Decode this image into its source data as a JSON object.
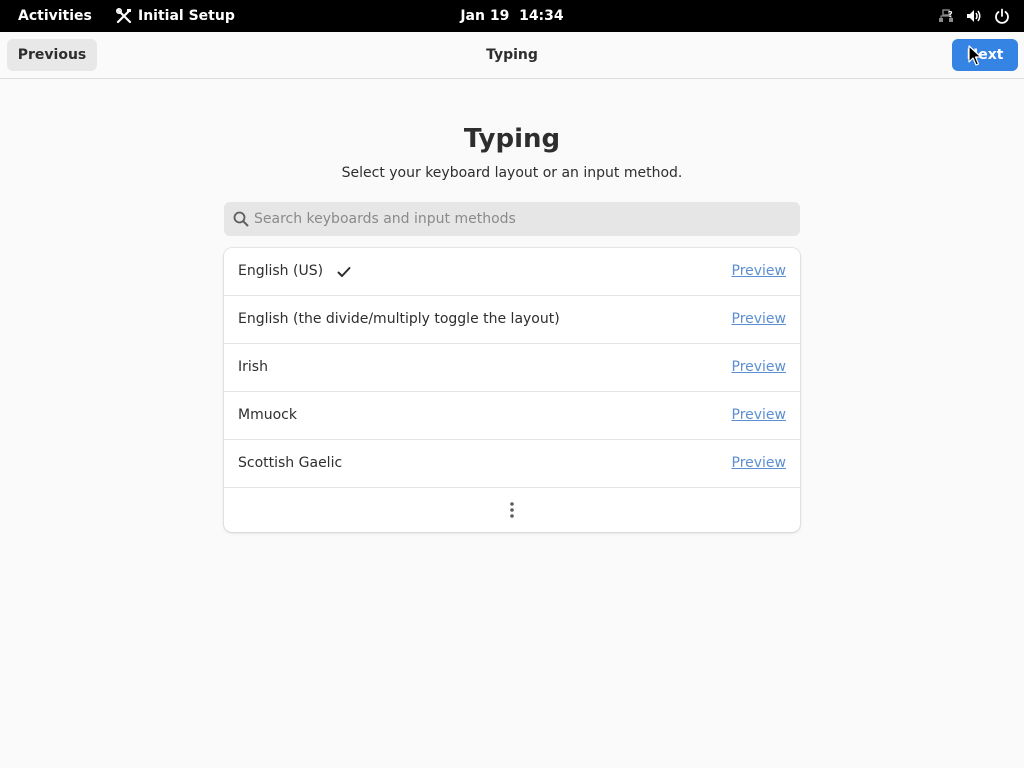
{
  "topbar": {
    "activities_label": "Activities",
    "app_name": "Initial Setup",
    "app_icon": "tools-icon",
    "clock": "Jan 19  14:34",
    "status_icons": [
      "network-unknown-icon",
      "volume-icon",
      "power-icon"
    ]
  },
  "header": {
    "previous_label": "Previous",
    "title": "Typing",
    "next_label": "Next"
  },
  "page": {
    "title": "Typing",
    "subtitle": "Select your keyboard layout or an input method."
  },
  "search": {
    "placeholder": "Search keyboards and input methods",
    "value": ""
  },
  "layouts": {
    "items": [
      {
        "name": "English (US)",
        "selected": true,
        "preview_label": "Preview"
      },
      {
        "name": "English (the divide/multiply toggle the layout)",
        "selected": false,
        "preview_label": "Preview"
      },
      {
        "name": "Irish",
        "selected": false,
        "preview_label": "Preview"
      },
      {
        "name": "Mmuock",
        "selected": false,
        "preview_label": "Preview"
      },
      {
        "name": "Scottish Gaelic",
        "selected": false,
        "preview_label": "Preview"
      }
    ],
    "more_icon": "view-more-icon"
  },
  "colors": {
    "accent": "#3584e4",
    "link": "#5b8ed1",
    "topbar_bg": "#000000",
    "window_bg": "#fafafa"
  }
}
